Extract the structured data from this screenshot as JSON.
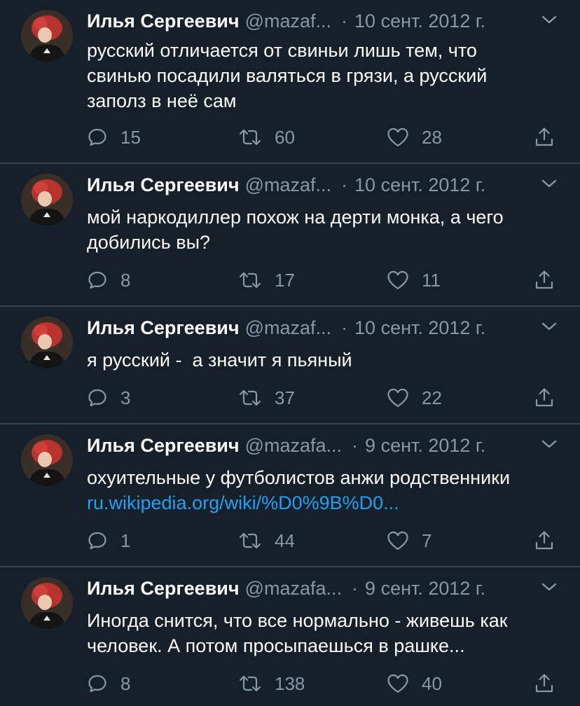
{
  "colors": {
    "background": "#15202b",
    "divider": "#38444d",
    "secondary_text": "#8899a6",
    "link": "#1da1f2",
    "primary_text": "#ffffff"
  },
  "icons": {
    "reply": "reply-icon",
    "retweet": "retweet-icon",
    "like": "heart-icon",
    "share": "share-icon",
    "menu": "chevron-down-icon"
  },
  "tweets": [
    {
      "name": "Илья Сергеевич",
      "handle": "@mazaf...",
      "separator": "·",
      "date": "10 сент. 2012 г.",
      "lines": [
        "русский отличается от свиньи лишь тем, что",
        "свинью посадили валяться в грязи, а русский",
        "заполз в неё сам"
      ],
      "link": "",
      "replies": "15",
      "retweets": "60",
      "likes": "28"
    },
    {
      "name": "Илья Сергеевич",
      "handle": "@mazaf...",
      "separator": "·",
      "date": "10 сент. 2012 г.",
      "lines": [
        "мой наркодиллер похож на дерти монка, а чего",
        "добились вы?"
      ],
      "link": "",
      "replies": "8",
      "retweets": "17",
      "likes": "11"
    },
    {
      "name": "Илья Сергеевич",
      "handle": "@mazaf...",
      "separator": "·",
      "date": "10 сент. 2012 г.",
      "lines": [
        "я русский -  а значит я пьяный"
      ],
      "link": "",
      "replies": "3",
      "retweets": "37",
      "likes": "22"
    },
    {
      "name": "Илья Сергеевич",
      "handle": "@mazafa...",
      "separator": "·",
      "date": "9 сент. 2012 г.",
      "lines": [
        "охуительные у футболистов анжи родственники"
      ],
      "link": "ru.wikipedia.org/wiki/%D0%9B%D0...",
      "replies": "1",
      "retweets": "44",
      "likes": "7"
    },
    {
      "name": "Илья Сергеевич",
      "handle": "@mazafa...",
      "separator": "·",
      "date": "9 сент. 2012 г.",
      "lines": [
        "Иногда снится, что все нормально - живешь как",
        "человек. А потом просыпаешься в рашке..."
      ],
      "link": "",
      "replies": "8",
      "retweets": "138",
      "likes": "40"
    }
  ]
}
